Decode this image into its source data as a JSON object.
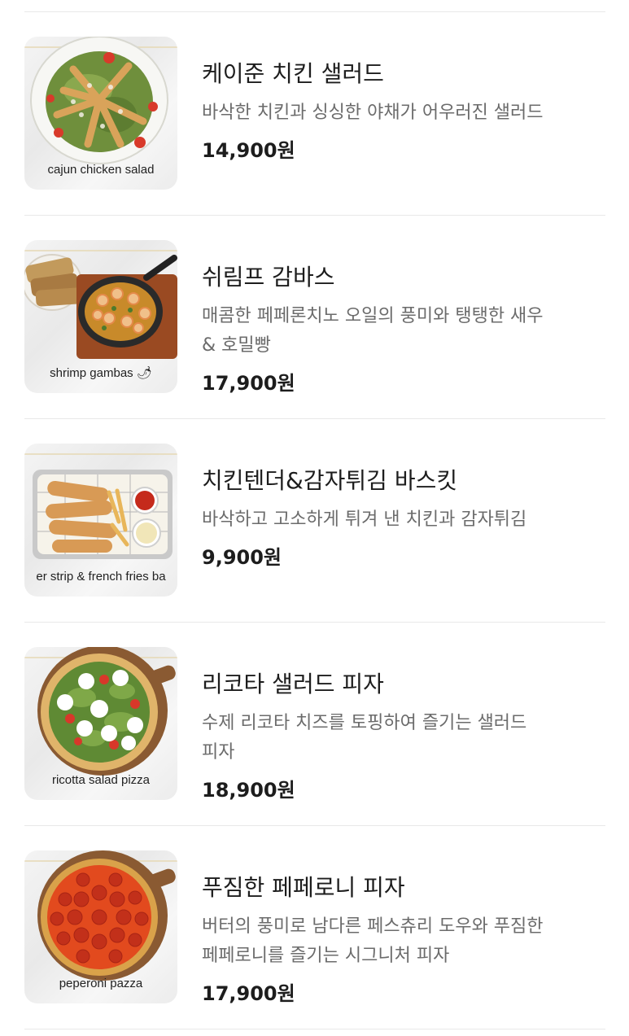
{
  "menu": {
    "items": [
      {
        "name": "케이준 치킨 샐러드",
        "description_lines": [
          "바삭한 치킨과 싱싱한 야채가 어우러진 샐러드"
        ],
        "price": "14,900원",
        "image_caption": "cajun chicken salad"
      },
      {
        "name": "쉬림프 감바스",
        "description_lines": [
          "매콤한 페페론치노 오일의 풍미와 탱탱한 새우",
          "& 호밀빵"
        ],
        "price": "17,900원",
        "image_caption": "shrimp gambas 🌶"
      },
      {
        "name": "치킨텐더&감자튀김 바스킷",
        "description_lines": [
          "바삭하고 고소하게 튀겨 낸 치킨과 감자튀김"
        ],
        "price": "9,900원",
        "image_caption": "er strip & french fries ba"
      },
      {
        "name": "리코타 샐러드 피자",
        "description_lines": [
          "수제 리코타 치즈를 토핑하여 즐기는 샐러드",
          "피자"
        ],
        "price": "18,900원",
        "image_caption": "ricotta salad pizza"
      },
      {
        "name": "푸짐한 페페로니 피자",
        "description_lines": [
          "버터의 풍미로 남다른 페스츄리 도우와 푸짐한",
          "페페로니를 즐기는 시그니처 피자"
        ],
        "price": "17,900원",
        "image_caption": "peperoni pazza"
      }
    ]
  }
}
